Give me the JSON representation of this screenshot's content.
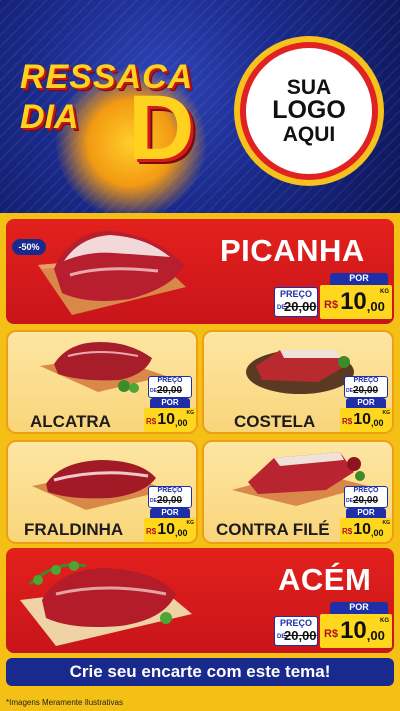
{
  "header": {
    "title_line1": "RESSACA",
    "title_line2": "DIA",
    "title_letter": "D",
    "logo_line1": "SUA",
    "logo_line2": "LOGO",
    "logo_line3": "AQUI"
  },
  "products": [
    {
      "name": "PICANHA",
      "discount": "-50%",
      "preco_label": "PREÇO",
      "de_label": "DE",
      "old_price": "20,00",
      "por_label": "POR",
      "currency": "R$",
      "price_int": "10",
      "price_dec": ",00",
      "unit": "KG"
    },
    {
      "name": "ALCATRA",
      "preco_label": "PREÇO",
      "de_label": "DE",
      "old_price": "20,00",
      "por_label": "POR",
      "currency": "R$",
      "price_int": "10",
      "price_dec": ",00",
      "unit": "KG"
    },
    {
      "name": "COSTELA",
      "preco_label": "PREÇO",
      "de_label": "DE",
      "old_price": "20,00",
      "por_label": "POR",
      "currency": "R$",
      "price_int": "10",
      "price_dec": ",00",
      "unit": "KG"
    },
    {
      "name": "FRALDINHA",
      "preco_label": "PREÇO",
      "de_label": "DE",
      "old_price": "20,00",
      "por_label": "POR",
      "currency": "R$",
      "price_int": "10",
      "price_dec": ",00",
      "unit": "KG"
    },
    {
      "name": "CONTRA FILÉ",
      "preco_label": "PREÇO",
      "de_label": "DE",
      "old_price": "20,00",
      "por_label": "POR",
      "currency": "R$",
      "price_int": "10",
      "price_dec": ",00",
      "unit": "KG"
    },
    {
      "name": "ACÉM",
      "preco_label": "PREÇO",
      "de_label": "DE",
      "old_price": "20,00",
      "por_label": "POR",
      "currency": "R$",
      "price_int": "10",
      "price_dec": ",00",
      "unit": "KG"
    }
  ],
  "cta": "Crie seu encarte com este tema!",
  "footnote": "*Imagens Meramente Ilustrativas",
  "colors": {
    "red": "#e3211c",
    "blue": "#1a2a8c",
    "yellow": "#f4c016"
  }
}
